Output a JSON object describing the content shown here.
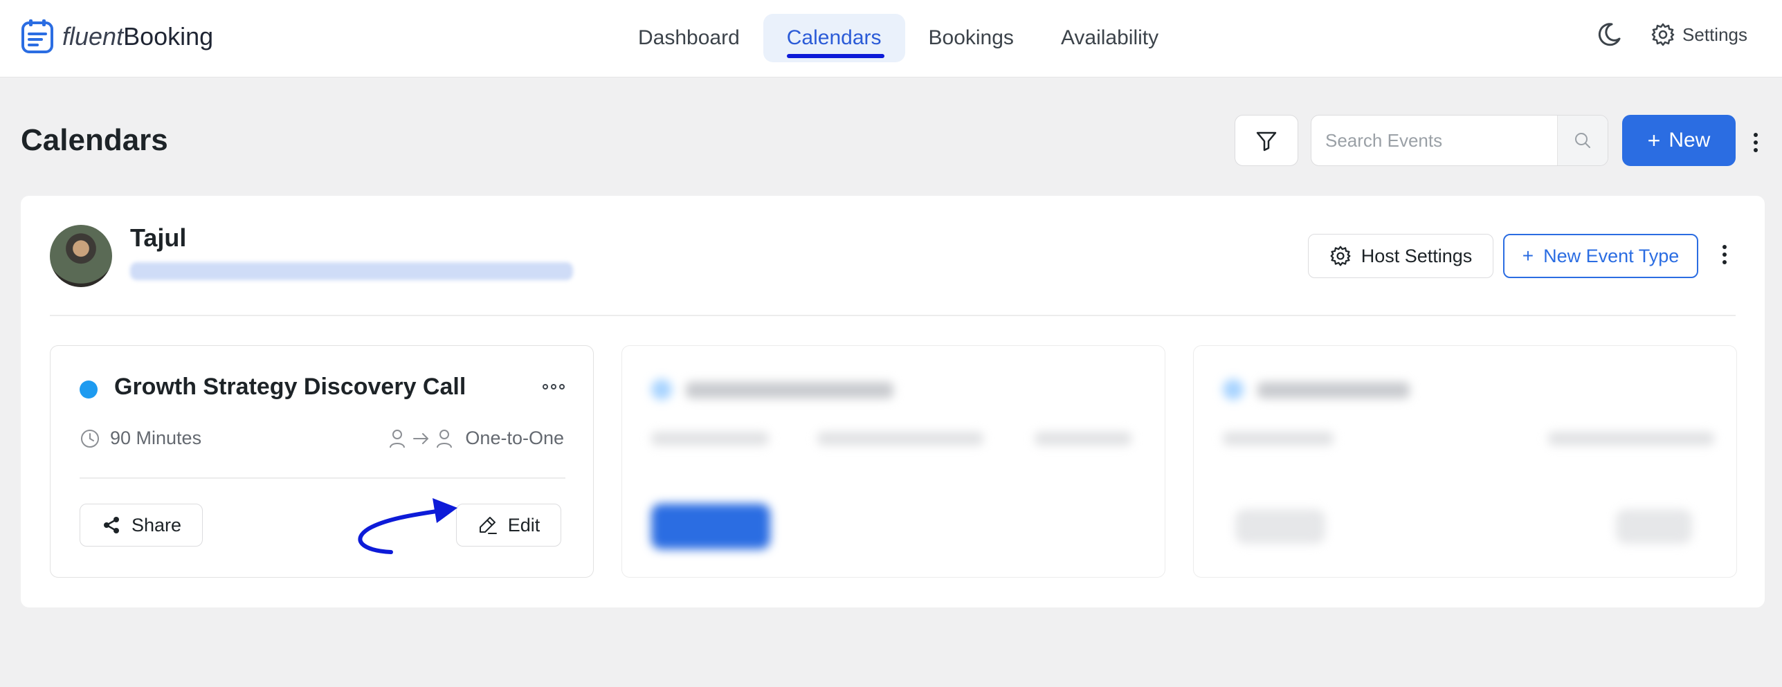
{
  "app": {
    "brand_part1": "fluent",
    "brand_part2": "Booking"
  },
  "nav": {
    "items": [
      {
        "label": "Dashboard"
      },
      {
        "label": "Calendars",
        "active": true
      },
      {
        "label": "Bookings"
      },
      {
        "label": "Availability"
      }
    ],
    "settings_label": "Settings"
  },
  "page": {
    "title": "Calendars",
    "search_placeholder": "Search Events",
    "new_label": "New"
  },
  "calendar": {
    "host_name": "Tajul",
    "host_settings_label": "Host Settings",
    "new_event_type_label": "New Event Type"
  },
  "event": {
    "title": "Growth Strategy Discovery Call",
    "duration": "90 Minutes",
    "type": "One-to-One",
    "share_label": "Share",
    "edit_label": "Edit",
    "dot_color": "#1e9bf0"
  },
  "colors": {
    "accent": "#2b6de2",
    "annotation_arrow": "#0d1bd8"
  }
}
